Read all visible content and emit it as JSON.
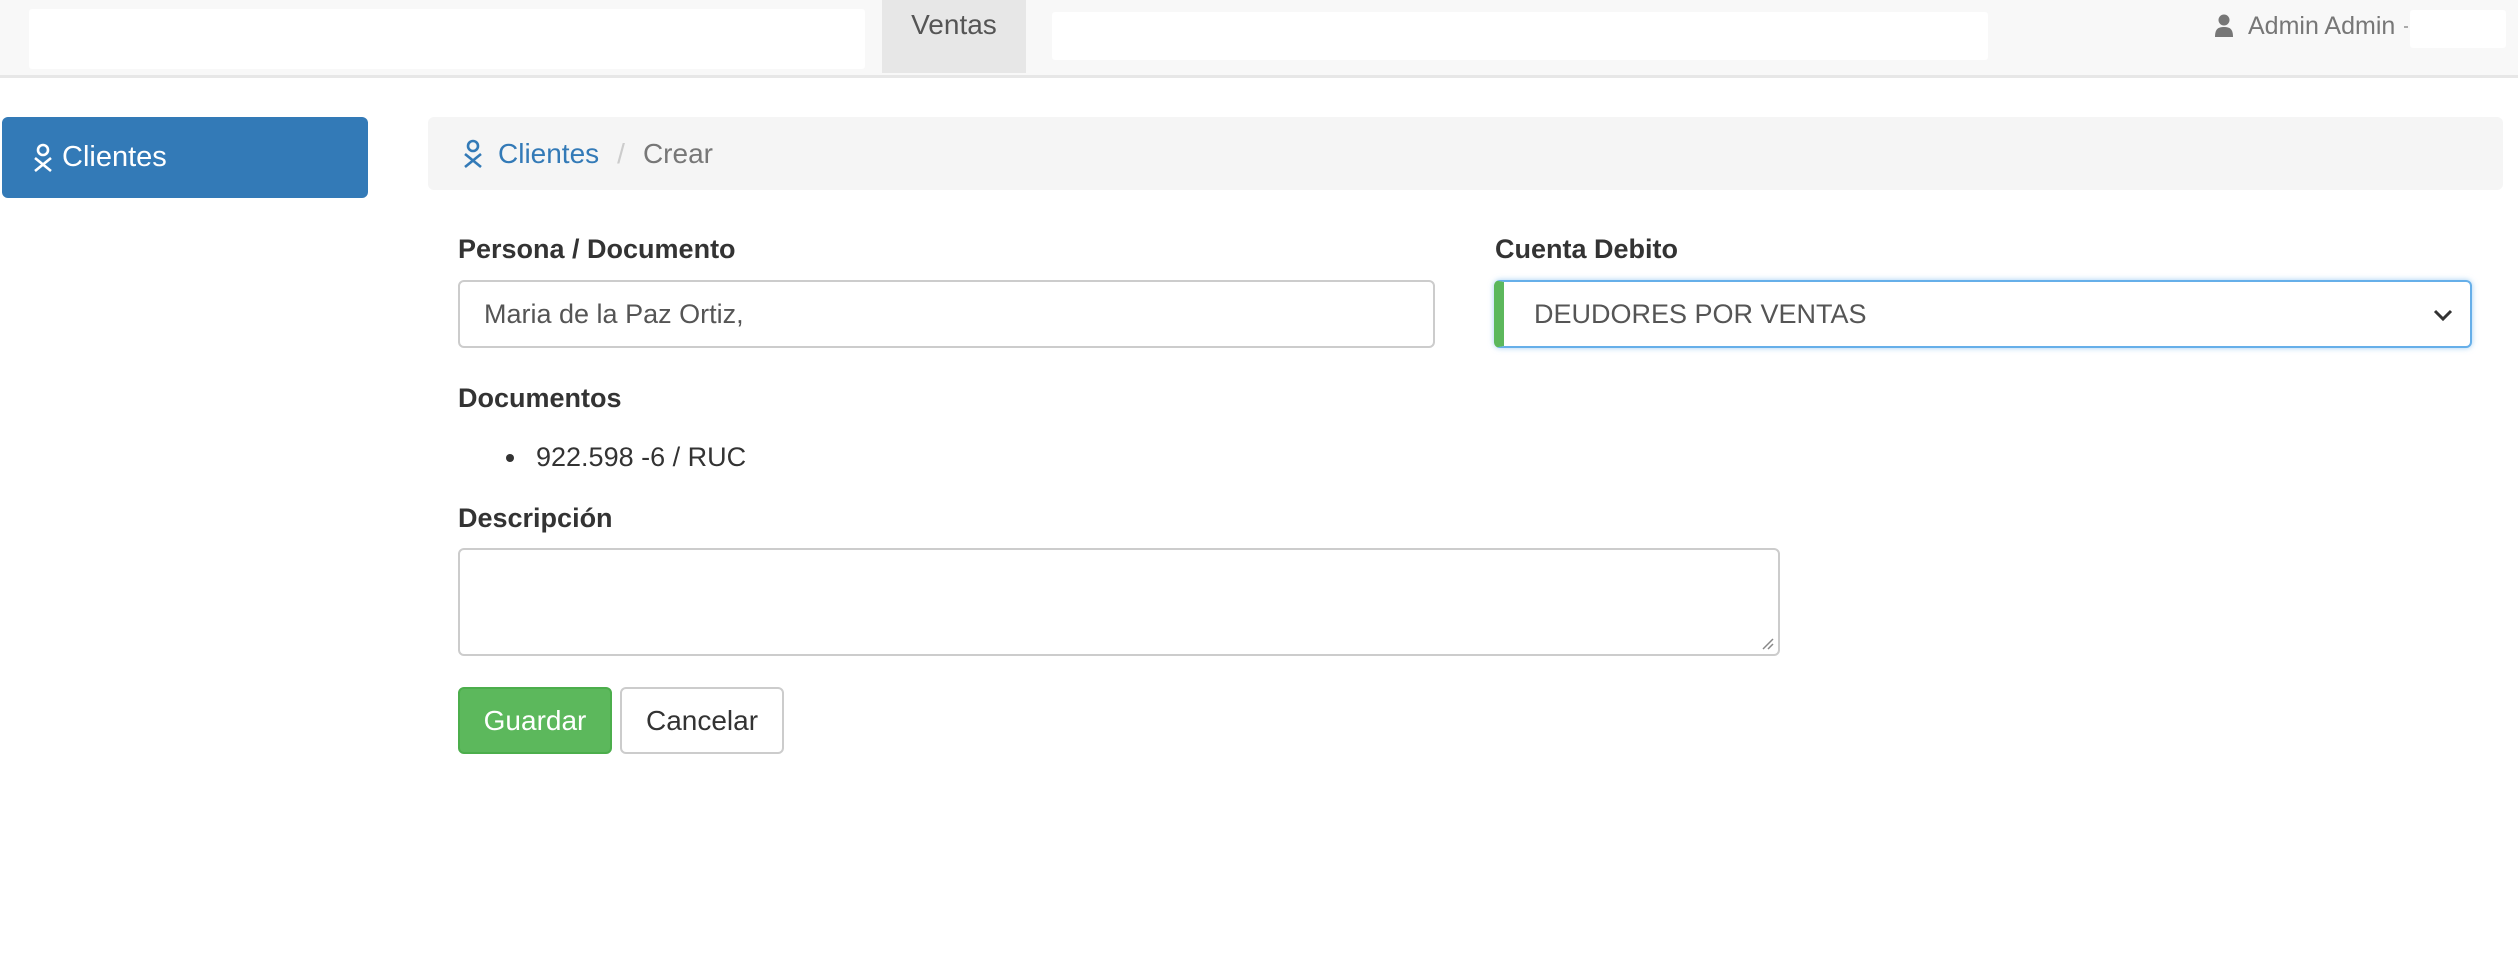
{
  "navbar": {
    "active_tab": "Ventas",
    "user_name": "Admin Admin"
  },
  "sidebar": {
    "items": [
      {
        "label": "Clientes",
        "icon": "person-icon",
        "active": true
      }
    ]
  },
  "breadcrumb": {
    "link_label": "Clientes",
    "separator": "/",
    "current": "Crear"
  },
  "form": {
    "persona": {
      "label": "Persona / Documento",
      "value": "Maria de la Paz Ortiz,"
    },
    "cuenta": {
      "label": "Cuenta Debito",
      "selected": "DEUDORES POR VENTAS"
    },
    "documentos": {
      "label": "Documentos",
      "items": [
        "922.598 -6 / RUC"
      ]
    },
    "descripcion": {
      "label": "Descripción",
      "value": ""
    },
    "buttons": {
      "save": "Guardar",
      "cancel": "Cancelar"
    }
  },
  "colors": {
    "primary": "#337ab7",
    "success": "#5cb85c",
    "navbar_bg": "#f8f8f8",
    "breadcrumb_bg": "#f5f5f5"
  }
}
